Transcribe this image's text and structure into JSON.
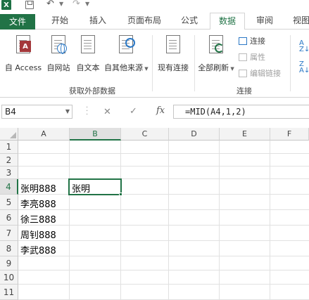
{
  "app": {
    "logo_letter": "X"
  },
  "tabs": [
    {
      "label": "文件"
    },
    {
      "label": "开始"
    },
    {
      "label": "插入"
    },
    {
      "label": "页面布局"
    },
    {
      "label": "公式"
    },
    {
      "label": "数据"
    },
    {
      "label": "审阅"
    },
    {
      "label": "视图"
    }
  ],
  "ribbon": {
    "group_external": {
      "label": "获取外部数据",
      "buttons": [
        {
          "label": "自 Access"
        },
        {
          "label": "自网站"
        },
        {
          "label": "自文本"
        },
        {
          "label": "自其他来源"
        },
        {
          "label": "现有连接"
        }
      ]
    },
    "group_connections": {
      "label": "连接",
      "refresh_all": "全部刷新",
      "connections": "连接",
      "properties": "属性",
      "edit_links": "编辑链接"
    },
    "access_badge": "A"
  },
  "formula_bar": {
    "name_box": "B4",
    "fx": "fx",
    "formula": "=MID(A4,1,2)"
  },
  "grid": {
    "columns": [
      "A",
      "B",
      "C",
      "D",
      "E",
      "F"
    ],
    "rows": [
      "1",
      "2",
      "3",
      "4",
      "5",
      "6",
      "7",
      "8",
      "9",
      "10",
      "11"
    ],
    "cells": {
      "A4": "张明888",
      "A5": "李亮888",
      "A6": "徐三888",
      "A7": "周钊888",
      "A8": "李武888",
      "B4": "张明"
    },
    "selected_cell": "B4"
  },
  "colors": {
    "excel_green": "#217346",
    "access_red": "#a4373a",
    "link_blue": "#2b78c5"
  }
}
